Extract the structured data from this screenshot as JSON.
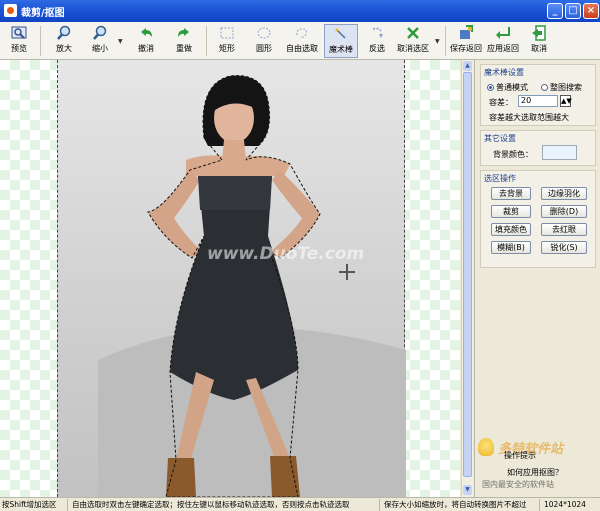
{
  "window": {
    "title": "裁剪/抠图"
  },
  "toolbar": {
    "preview": "预览",
    "zoom_in": "放大",
    "zoom_out": "缩小",
    "undo": "撤消",
    "redo": "重做",
    "rect": "矩形",
    "ellipse": "圆形",
    "freehand": "自由选取",
    "magic_wand": "魔术棒",
    "invert": "反选",
    "deselect": "取消选区",
    "save_return": "保存返回",
    "apply_return": "应用返回",
    "cancel": "取消"
  },
  "canvas": {
    "watermark": "www.DuoTe.com"
  },
  "panel": {
    "magic_title": "魔术棒设置",
    "mode_normal": "普通模式",
    "mode_global": "整图搜索",
    "tolerance_label": "容差：",
    "tolerance_value": "20",
    "tolerance_hint": "容差越大选取范围越大",
    "other_title": "其它设置",
    "bg_label": "背景颜色：",
    "bg_color": "#EAF2FB",
    "ops_title": "选区操作",
    "btn_remove_bg": "去背景",
    "btn_feather": "边缘羽化",
    "btn_crop": "裁剪",
    "btn_delete": "删除(D)",
    "btn_fill": "填充颜色",
    "btn_redeye": "去红眼",
    "btn_blur": "模糊(B)",
    "btn_sharpen": "锐化(S)"
  },
  "hint": {
    "logo": "多特软件站",
    "line1": "操作提示",
    "line2": "如何应用抠图？",
    "line3": "国内最安全的软件站"
  },
  "status": {
    "s1": "按Shift增加选区",
    "s2": "自由选取时双击左键确定选取；按住左键以鼠标移动轨迹选取，否则按点击轨迹选取",
    "s3": "保存大小如缩放时，将自动转换图片不超过",
    "s4": "1024*1024"
  }
}
